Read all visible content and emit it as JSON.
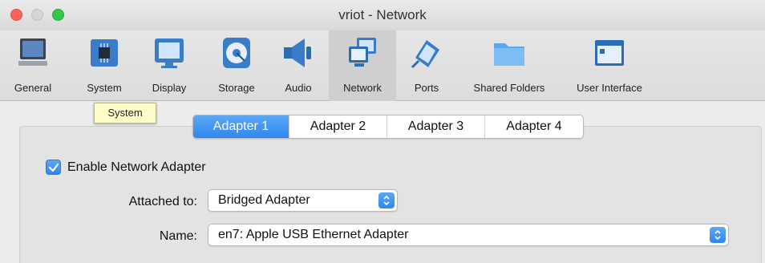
{
  "window": {
    "title": "vriot - Network"
  },
  "toolbar": {
    "items": [
      {
        "label": "General",
        "icon": "monitor-icon"
      },
      {
        "label": "System",
        "icon": "chip-icon"
      },
      {
        "label": "Display",
        "icon": "display-icon"
      },
      {
        "label": "Storage",
        "icon": "disk-icon"
      },
      {
        "label": "Audio",
        "icon": "speaker-icon"
      },
      {
        "label": "Network",
        "icon": "network-icon"
      },
      {
        "label": "Ports",
        "icon": "plug-icon"
      },
      {
        "label": "Shared Folders",
        "icon": "folder-icon"
      },
      {
        "label": "User Interface",
        "icon": "window-icon"
      }
    ],
    "selected": "Network"
  },
  "tooltip": {
    "text": "System"
  },
  "tabs": [
    {
      "label": "Adapter 1"
    },
    {
      "label": "Adapter 2"
    },
    {
      "label": "Adapter 3"
    },
    {
      "label": "Adapter 4"
    }
  ],
  "adapter": {
    "enable_label": "Enable Network Adapter",
    "enabled": true,
    "attached_to_label": "Attached to:",
    "attached_to_value": "Bridged Adapter",
    "name_label": "Name:",
    "name_value": "en7: Apple USB Ethernet Adapter"
  },
  "colors": {
    "accent": "#2f86ee",
    "tooltip_bg": "#fffec8"
  }
}
